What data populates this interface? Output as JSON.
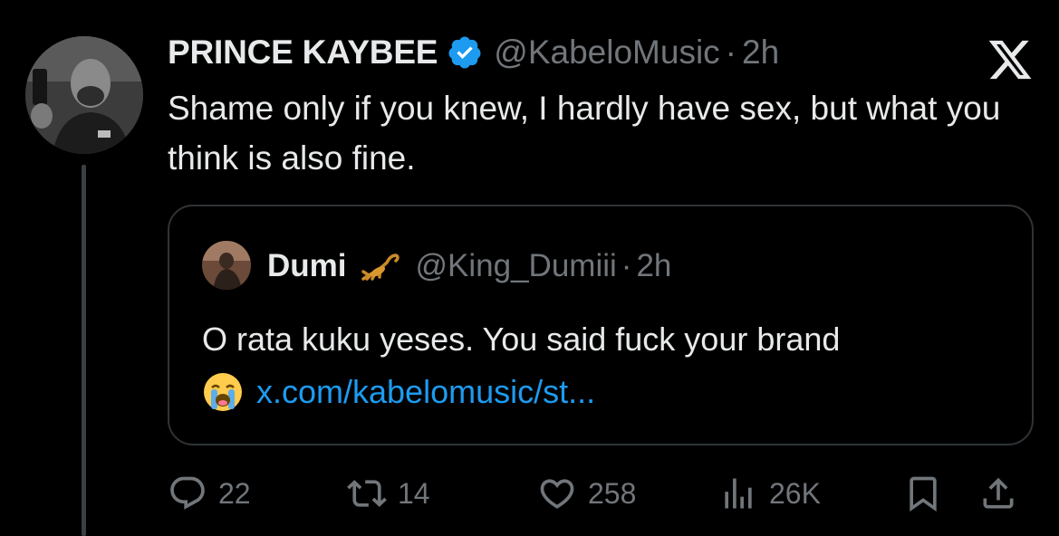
{
  "tweet": {
    "display_name": "PRINCE KAYBEE",
    "handle": "@KabeloMusic",
    "separator": "·",
    "time": "2h",
    "text": "Shame only if you knew, I hardly have sex, but what you think is also fine.",
    "verified": true
  },
  "quote": {
    "display_name": "Dumi",
    "name_emoji": "scorpion",
    "handle": "@King_Dumiii",
    "separator": "·",
    "time": "2h",
    "text_line1": "O rata kuku yeses. You said fuck your brand",
    "text_emoji": "loudly-crying-face",
    "link": "x.com/kabelomusic/st..."
  },
  "actions": {
    "replies": "22",
    "reposts": "14",
    "likes": "258",
    "views": "26K"
  },
  "colors": {
    "background": "#000000",
    "text": "#e7e9ea",
    "muted": "#71767b",
    "link": "#1d9bf0",
    "verified": "#1d9bf0",
    "border": "#2f3336"
  },
  "icons": {
    "brand": "x-logo-icon",
    "verified": "verified-badge-icon",
    "reply": "reply-icon",
    "repost": "repost-icon",
    "like": "heart-icon",
    "views": "views-icon",
    "bookmark": "bookmark-icon",
    "share": "share-icon"
  }
}
